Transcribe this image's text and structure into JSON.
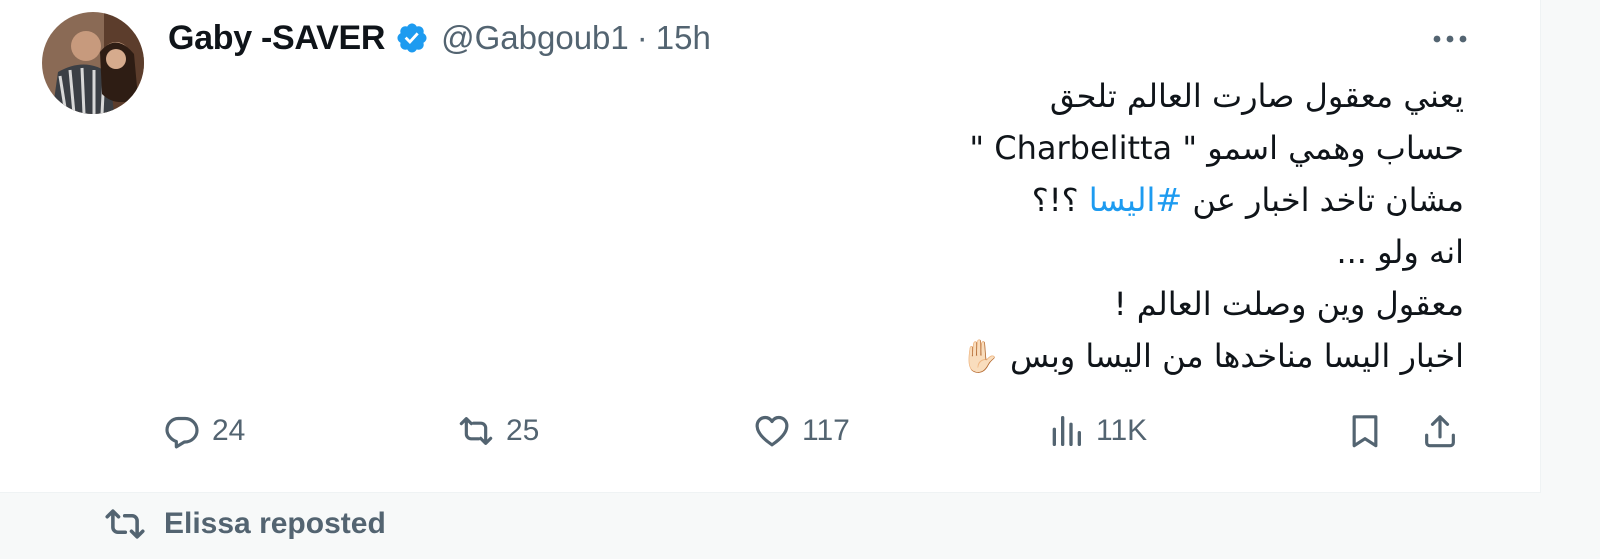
{
  "tweet": {
    "author": {
      "display_name": "Gaby -SAVER",
      "verified": true,
      "handle": "@Gabgoub1",
      "separator": "·",
      "time": "15h"
    },
    "body_lines": [
      {
        "text": "يعني معقول صارت العالم تلحق"
      },
      {
        "text": "حساب وهمي اسمو \" Charbelitta \""
      },
      {
        "before": "مشان تاخد اخبار عن ",
        "hashtag": "#اليسا",
        "after": " ؟!؟"
      },
      {
        "text": "انه ولو ..."
      },
      {
        "text": "معقول وين وصلت العالم !"
      },
      {
        "text": "اخبار اليسا مناخدها من اليسا وبس",
        "emoji": "✋🏻"
      }
    ],
    "stats": {
      "replies": "24",
      "reposts": "25",
      "likes": "117",
      "views": "11K"
    },
    "icons": {
      "more": "more-horizontal-icon",
      "reply": "reply-icon",
      "repost": "repost-icon",
      "like": "heart-icon",
      "views": "views-chart-icon",
      "bookmark": "bookmark-icon",
      "share": "share-icon"
    }
  },
  "next_item": {
    "repost_label": "Elissa reposted"
  },
  "colors": {
    "accent": "#1d9bf0",
    "secondary_text": "#536471",
    "text": "#0f1419"
  }
}
